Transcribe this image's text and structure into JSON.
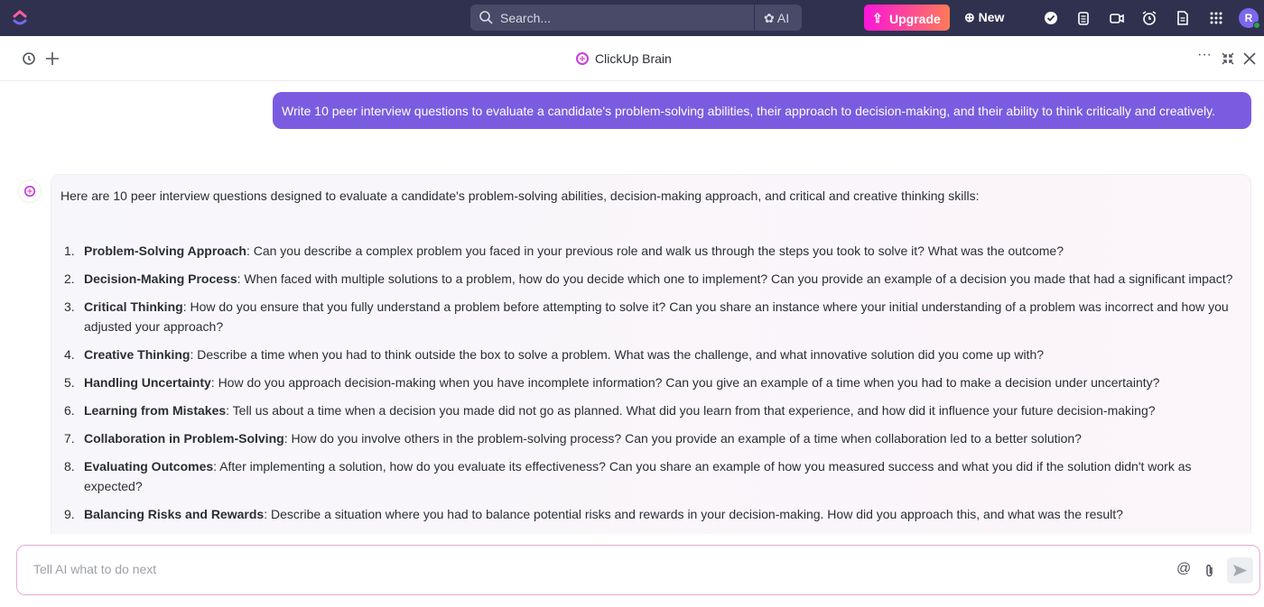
{
  "topbar": {
    "search_placeholder": "Search...",
    "ai_label": "AI",
    "upgrade_label": "Upgrade",
    "new_label": "New",
    "avatar_initial": "R",
    "colors": {
      "bg": "#30314f",
      "upgrade_start": "#fb15d8",
      "upgrade_end": "#fe7a57"
    }
  },
  "header": {
    "title": "ClickUp Brain"
  },
  "chat": {
    "user_message": "Write 10 peer interview questions to evaluate a candidate's problem-solving abilities, their approach to decision-making, and their ability to think critically and creatively.",
    "response_intro": "Here are 10 peer interview questions designed to evaluate a candidate's problem-solving abilities, decision-making approach, and critical and creative thinking skills:",
    "items": [
      {
        "num": "1.",
        "title": "Problem-Solving Approach",
        "text": ": Can you describe a complex problem you faced in your previous role and walk us through the steps you took to solve it? What was the outcome?"
      },
      {
        "num": "2.",
        "title": "Decision-Making Process",
        "text": ": When faced with multiple solutions to a problem, how do you decide which one to implement? Can you provide an example of a decision you made that had a significant impact?"
      },
      {
        "num": "3.",
        "title": "Critical Thinking",
        "text": ": How do you ensure that you fully understand a problem before attempting to solve it? Can you share an instance where your initial understanding of a problem was incorrect and how you adjusted your approach?"
      },
      {
        "num": "4.",
        "title": "Creative Thinking",
        "text": ": Describe a time when you had to think outside the box to solve a problem. What was the challenge, and what innovative solution did you come up with?"
      },
      {
        "num": "5.",
        "title": "Handling Uncertainty",
        "text": ": How do you approach decision-making when you have incomplete information? Can you give an example of a time when you had to make a decision under uncertainty?"
      },
      {
        "num": "6.",
        "title": "Learning from Mistakes",
        "text": ": Tell us about a time when a decision you made did not go as planned. What did you learn from that experience, and how did it influence your future decision-making?"
      },
      {
        "num": "7.",
        "title": "Collaboration in Problem-Solving",
        "text": ": How do you involve others in the problem-solving process? Can you provide an example of a time when collaboration led to a better solution?"
      },
      {
        "num": "8.",
        "title": "Evaluating Outcomes",
        "text": ": After implementing a solution, how do you evaluate its effectiveness? Can you share an example of how you measured success and what you did if the solution didn't work as expected?"
      },
      {
        "num": "9.",
        "title": "Balancing Risks and Rewards",
        "text": ": Describe a situation where you had to balance potential risks and rewards in your decision-making. How did you approach this, and what was the result?"
      }
    ],
    "user_bubble_color": "#7b5ce0"
  },
  "composer": {
    "placeholder": "Tell AI what to do next"
  }
}
